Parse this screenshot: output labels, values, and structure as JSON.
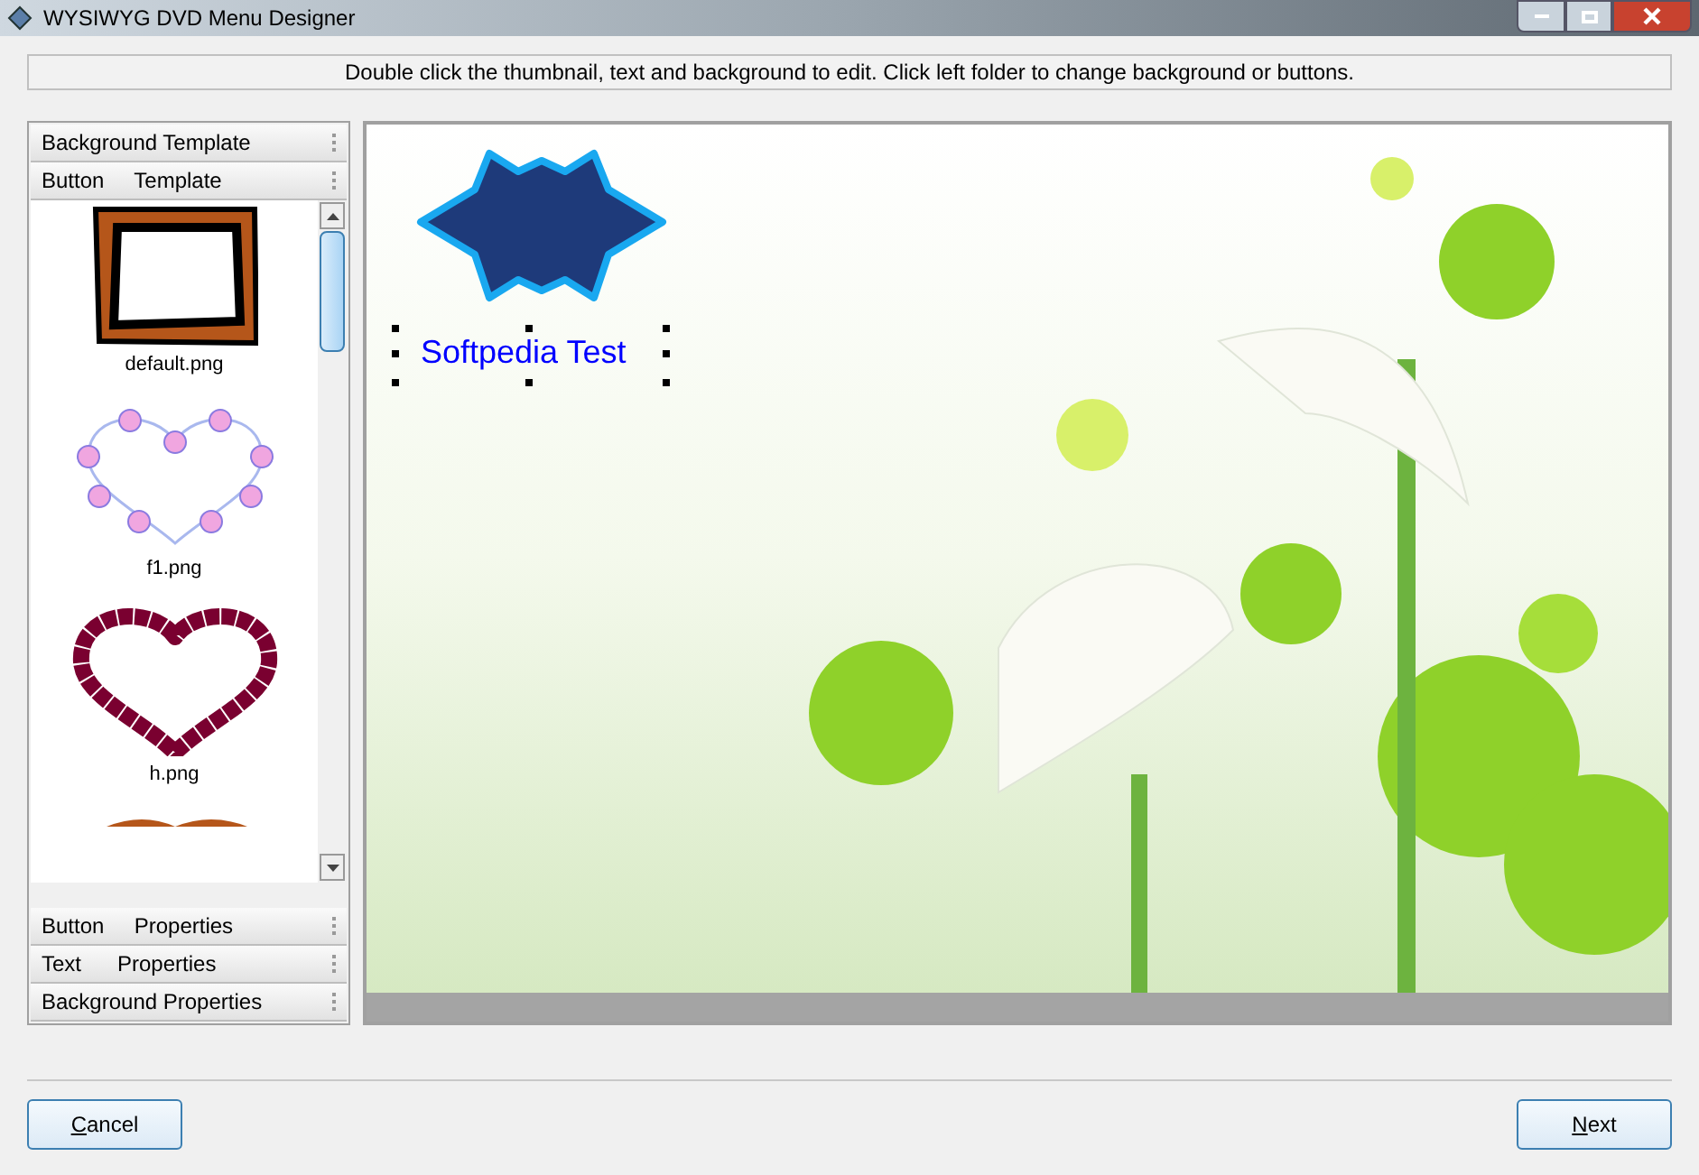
{
  "window": {
    "title": "WYSIWYG DVD Menu Designer"
  },
  "instruction": "Double click the thumbnail, text and background to edit. Click left folder to change background or buttons.",
  "sidebar": {
    "top_sections": [
      {
        "label": "Background Template"
      },
      {
        "label": "Button     Template"
      }
    ],
    "thumbnails": [
      {
        "kind": "frame",
        "label": "default.png"
      },
      {
        "kind": "rose-heart",
        "label": "f1.png"
      },
      {
        "kind": "scallop-heart",
        "label": "h.png"
      },
      {
        "kind": "partial"
      }
    ],
    "bottom_sections": [
      {
        "label": "Button     Properties"
      },
      {
        "label": "Text      Properties"
      },
      {
        "label": "Background Properties"
      }
    ]
  },
  "canvas": {
    "menu_text": {
      "label": "Softpedia Test",
      "selected": true
    }
  },
  "buttons": [
    {
      "label": "Cancel"
    },
    {
      "label": "Next"
    }
  ]
}
